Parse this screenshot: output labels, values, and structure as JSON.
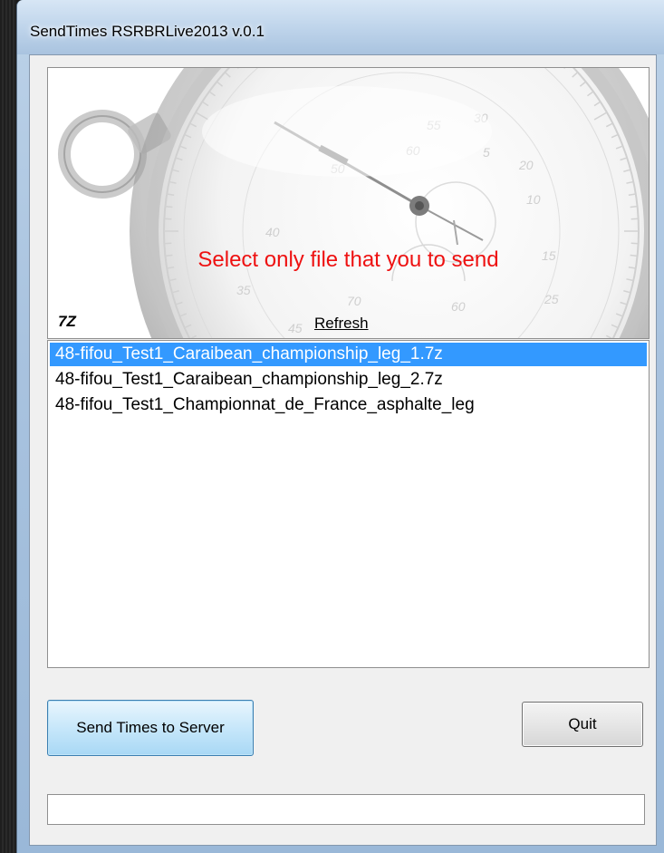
{
  "window": {
    "title": "SendTimes RSRBRLive2013 v.0.1"
  },
  "banner": {
    "instruction": "Select only file that you to send",
    "extension_label": "7Z",
    "refresh_label": "Refresh",
    "instruction_color": "#ee1111"
  },
  "file_list": {
    "items": [
      {
        "label": "48-fifou_Test1_Caraibean_championship_leg_1.7z",
        "selected": true
      },
      {
        "label": "48-fifou_Test1_Caraibean_championship_leg_2.7z",
        "selected": false
      },
      {
        "label": "48-fifou_Test1_Championnat_de_France_asphalte_leg",
        "selected": false
      }
    ],
    "selection_color": "#3399ff"
  },
  "buttons": {
    "send_label": "Send Times to Server",
    "quit_label": "Quit"
  },
  "status": {
    "text": ""
  },
  "icons": {
    "background_image": "stopwatch-image"
  }
}
